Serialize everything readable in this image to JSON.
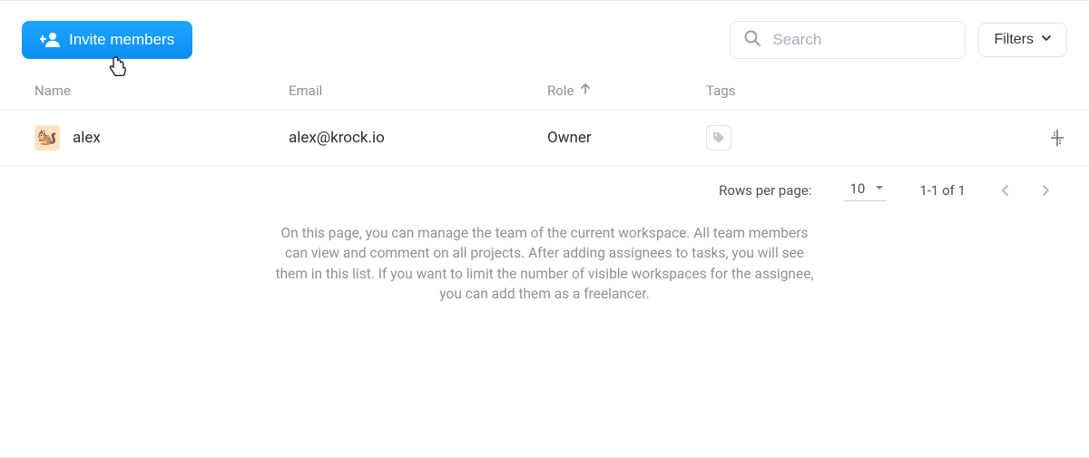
{
  "toolbar": {
    "invite_label": "Invite members",
    "filters_label": "Filters"
  },
  "search": {
    "placeholder": "Search"
  },
  "columns": {
    "name": "Name",
    "email": "Email",
    "role": "Role",
    "tags": "Tags"
  },
  "rows": [
    {
      "avatar_emoji": "🐿️",
      "name": "alex",
      "email": "alex@krock.io",
      "role": "Owner"
    }
  ],
  "pagination": {
    "rows_label": "Rows per page:",
    "rows_value": "10",
    "range": "1-1 of 1"
  },
  "help_text": "On this page, you can manage the team of the current workspace. All team members can view and comment on all projects. After adding assignees to tasks, you will see them in this list. If you want to limit the number of visible workspaces for the assignee, you can add them as a freelancer."
}
